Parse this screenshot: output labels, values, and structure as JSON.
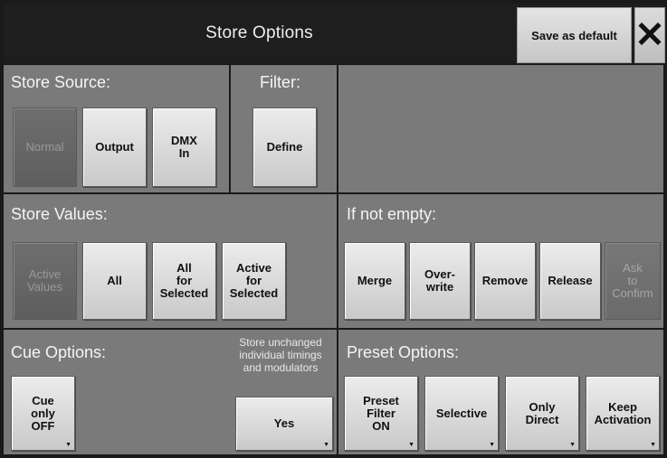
{
  "header": {
    "title": "Store Options",
    "save_default_label": "Save as default",
    "close_icon": "close-icon",
    "close_glyph": "✕"
  },
  "store_source": {
    "title": "Store Source:",
    "buttons": [
      {
        "label": "Normal",
        "state": "active"
      },
      {
        "label": "Output",
        "state": "normal"
      },
      {
        "label": "DMX\nIn",
        "state": "normal"
      }
    ]
  },
  "filter": {
    "title": "Filter:",
    "define_label": "Define"
  },
  "store_values": {
    "title": "Store Values:",
    "buttons": [
      {
        "label": "Active\nValues",
        "state": "active"
      },
      {
        "label": "All",
        "state": "normal"
      },
      {
        "label": "All\nfor\nSelected",
        "state": "normal"
      },
      {
        "label": "Active\nfor\nSelected",
        "state": "normal"
      }
    ]
  },
  "if_not_empty": {
    "title": "If not empty:",
    "buttons": [
      {
        "label": "Merge",
        "state": "normal"
      },
      {
        "label": "Over-\nwrite",
        "state": "normal"
      },
      {
        "label": "Remove",
        "state": "normal"
      },
      {
        "label": "Release",
        "state": "normal"
      },
      {
        "label": "Ask\nto\nConfirm",
        "state": "disabled"
      }
    ]
  },
  "cue_options": {
    "title": "Cue Options:",
    "cue_only_label": "Cue\nonly\nOFF",
    "note": "Store unchanged\nindividual timings\nand modulators",
    "yes_label": "Yes"
  },
  "preset_options": {
    "title": "Preset Options:",
    "buttons": [
      {
        "label": "Preset\nFilter\nON"
      },
      {
        "label": "Selective"
      },
      {
        "label": "Only\nDirect"
      },
      {
        "label": "Keep\nActivation"
      }
    ]
  },
  "colors": {
    "panel": "#7a7a7a",
    "background": "#1a1a1a",
    "button": "#dcdcdc",
    "active_button": "#666666"
  },
  "icons": {
    "dropdown": "dropdown-caret-icon",
    "caret_glyph": "▼"
  }
}
